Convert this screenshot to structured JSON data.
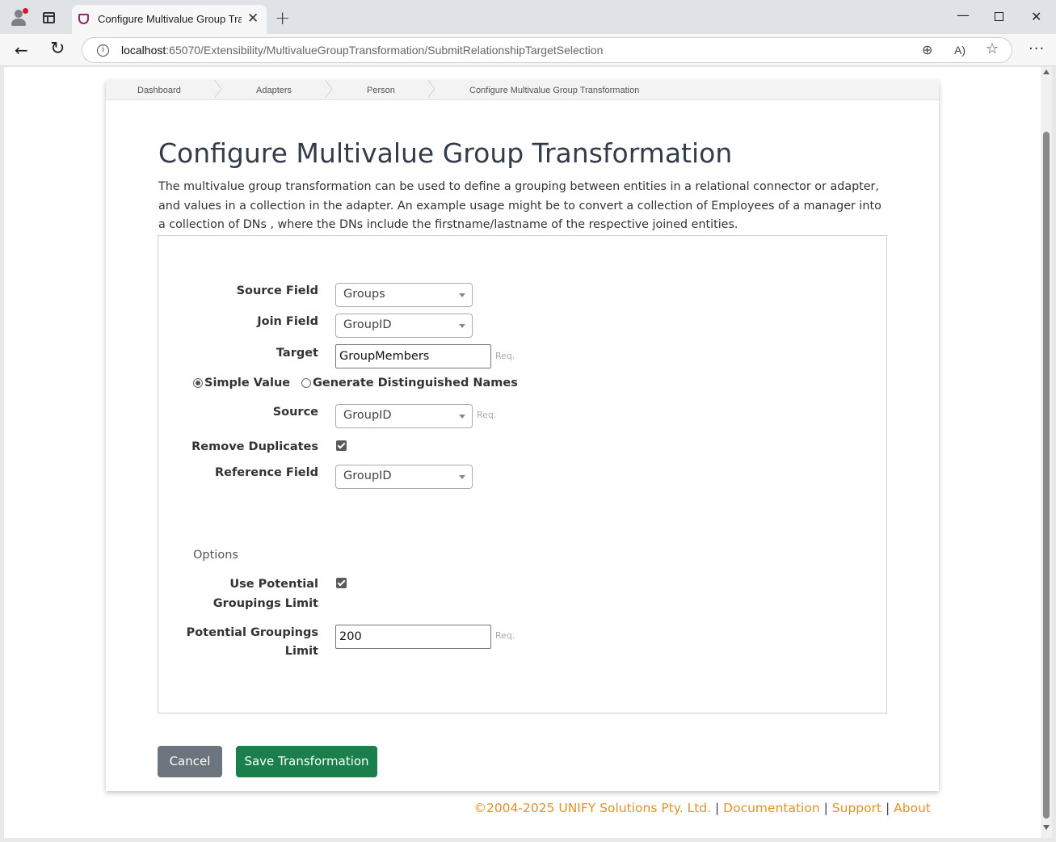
{
  "browser": {
    "tab_title": "Configure Multivalue Group Trans",
    "url_host": "localhost",
    "url_rest": ":65070/Extensibility/MultivalueGroupTransformation/SubmitRelationshipTargetSelection",
    "info_glyph": "i",
    "zoom_glyph": "⊕",
    "read_aloud_glyph": "A)",
    "favorite_glyph": "☆",
    "menu_glyph": "···"
  },
  "breadcrumb": [
    "Dashboard",
    "Adapters",
    "Person",
    "Configure Multivalue Group Transformation"
  ],
  "page": {
    "title": "Configure Multivalue Group Transformation",
    "description": "The multivalue group transformation can be used to define a grouping between entities in a relational connector or adapter, and values in a collection in the adapter. An example usage might be to convert a collection of Employees of a manager into a collection of DNs , where the DNs include the firstname/lastname of the respective joined entities."
  },
  "form": {
    "source_field_label": "Source Field",
    "source_field_value": "Groups",
    "join_field_label": "Join Field",
    "join_field_value": "GroupID",
    "target_label": "Target",
    "target_value": "GroupMembers",
    "req": "Req.",
    "radio_simple": "Simple Value",
    "radio_dn": "Generate Distinguished Names",
    "source_label": "Source",
    "source_value": "GroupID",
    "remove_duplicates_label": "Remove Duplicates",
    "reference_field_label": "Reference Field",
    "reference_field_value": "GroupID",
    "options_heading": "Options",
    "use_limit_label_1": "Use Potential",
    "use_limit_label_2": "Groupings Limit",
    "limit_label_1": "Potential Groupings",
    "limit_label_2": "Limit",
    "limit_value": "200"
  },
  "buttons": {
    "cancel": "Cancel",
    "save": "Save Transformation"
  },
  "footer": {
    "copyright": "©2004-2025 UNIFY Solutions Pty. Ltd.",
    "separator": "|",
    "documentation": "Documentation",
    "support": "Support",
    "about": "About"
  },
  "colors": {
    "save_button": "#1a7f4a",
    "cancel_button": "#6c747d",
    "footer_link": "#e0922a"
  }
}
